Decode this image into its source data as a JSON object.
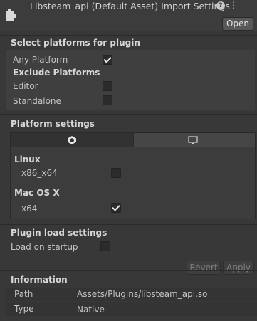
{
  "header": {
    "title": "Libsteam_api (Default Asset) Import Settings",
    "open_label": "Open"
  },
  "platforms": {
    "heading": "Select platforms for plugin",
    "any_platform_label": "Any Platform",
    "any_platform_checked": true,
    "exclude_heading": "Exclude Platforms",
    "editor_label": "Editor",
    "editor_checked": false,
    "standalone_label": "Standalone",
    "standalone_checked": false
  },
  "platform_settings": {
    "heading": "Platform settings",
    "tabs": [
      {
        "icon": "unity-icon",
        "selected": true
      },
      {
        "icon": "desktop-icon",
        "selected": false
      }
    ],
    "linux_heading": "Linux",
    "linux_x86_x64_label": "x86_x64",
    "linux_x86_x64_checked": false,
    "mac_heading": "Mac OS X",
    "mac_x64_label": "x64",
    "mac_x64_checked": true
  },
  "load_settings": {
    "heading": "Plugin load settings",
    "load_on_startup_label": "Load on startup",
    "load_on_startup_checked": false,
    "revert_label": "Revert",
    "apply_label": "Apply"
  },
  "information": {
    "heading": "Information",
    "path_label": "Path",
    "path_value": "Assets/Plugins/libsteam_api.so",
    "type_label": "Type",
    "type_value": "Native"
  }
}
